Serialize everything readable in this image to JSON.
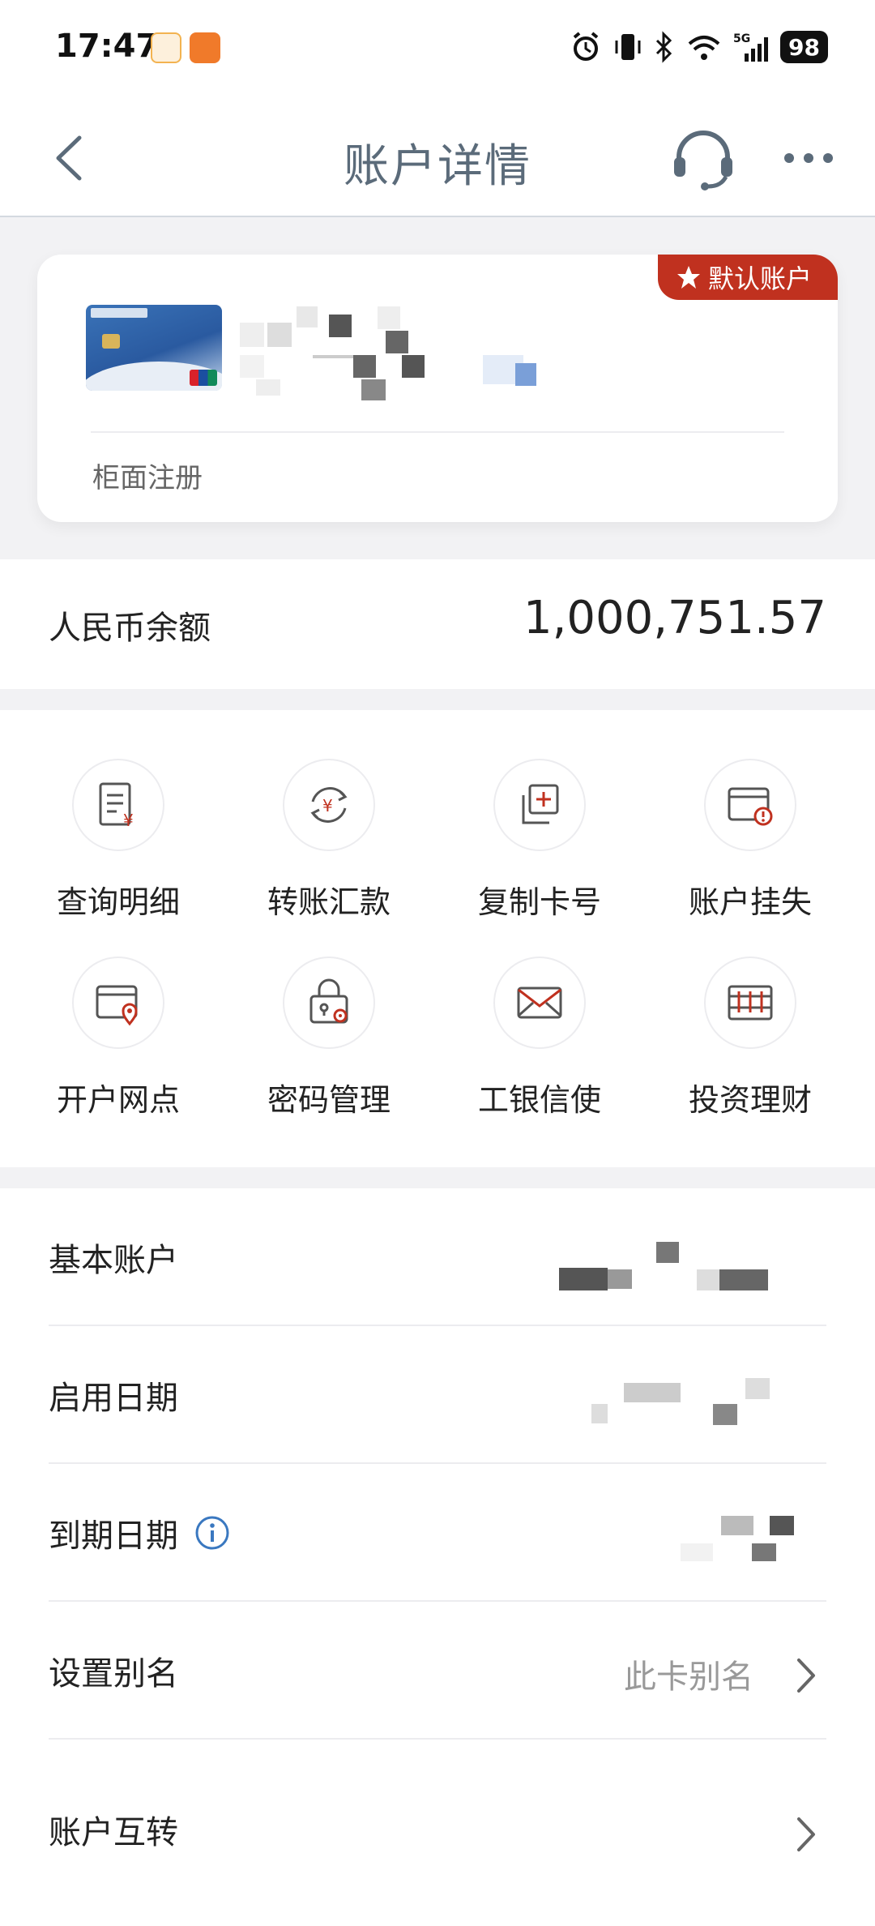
{
  "status": {
    "time": "17:47",
    "battery": "98",
    "network": "5G"
  },
  "nav": {
    "title": "账户详情"
  },
  "card": {
    "badge": "默认账户",
    "registration": "柜面注册"
  },
  "balance": {
    "label": "人民币余额",
    "value": "1,000,751.57"
  },
  "actions": [
    {
      "label": "查询明细",
      "icon": "query-detail-icon"
    },
    {
      "label": "转账汇款",
      "icon": "transfer-icon"
    },
    {
      "label": "复制卡号",
      "icon": "copy-card-icon"
    },
    {
      "label": "账户挂失",
      "icon": "report-loss-icon"
    },
    {
      "label": "开户网点",
      "icon": "branch-location-icon"
    },
    {
      "label": "密码管理",
      "icon": "password-lock-icon"
    },
    {
      "label": "工银信使",
      "icon": "envelope-icon"
    },
    {
      "label": "投资理财",
      "icon": "investment-icon"
    }
  ],
  "info": [
    {
      "label": "基本账户"
    },
    {
      "label": "启用日期"
    },
    {
      "label": "到期日期"
    },
    {
      "label": "设置别名",
      "value": "此卡别名"
    },
    {
      "label": "账户互转"
    }
  ],
  "colors": {
    "accent_red": "#c0311f",
    "nav_title": "#5b6b7a",
    "info_blue": "#3a78c0"
  }
}
